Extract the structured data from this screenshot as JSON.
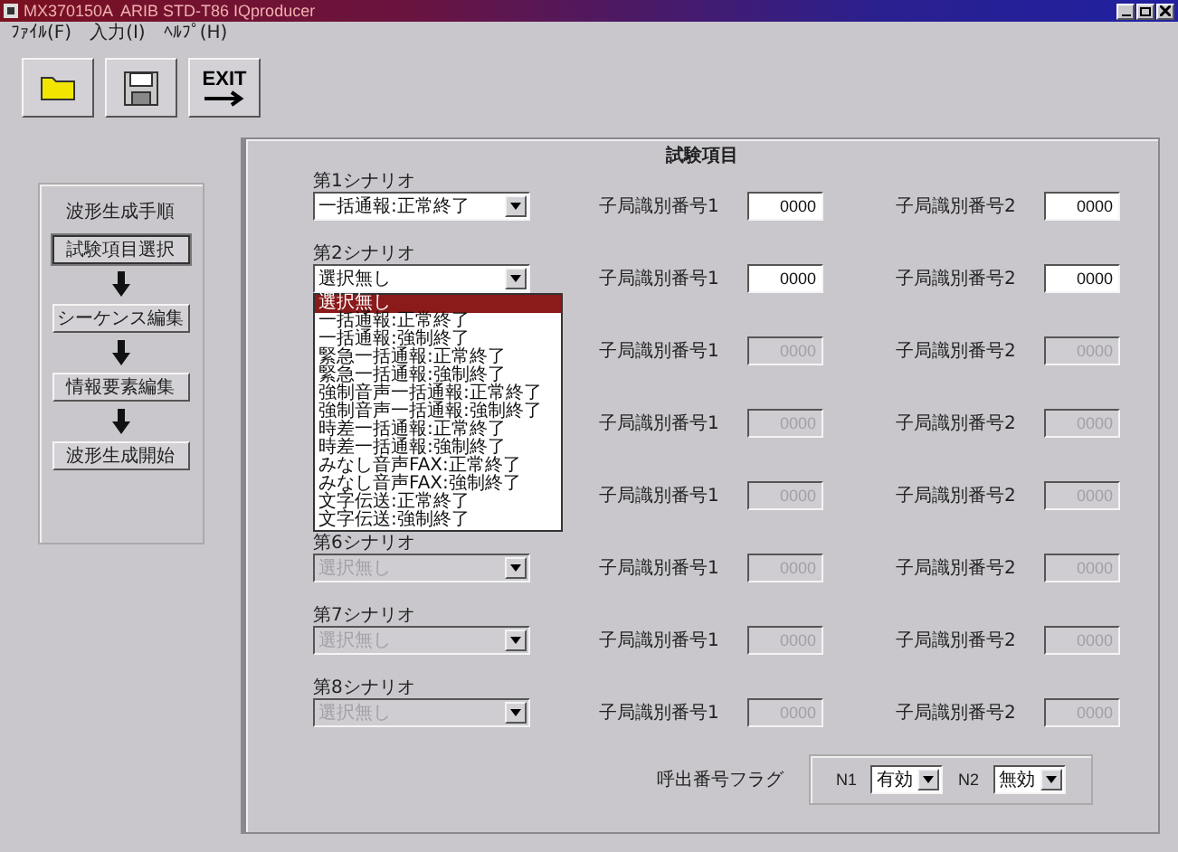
{
  "window": {
    "title": "MX370150A  ARIB STD-T86 IQproducer",
    "menu": [
      "ﾌｧｲﾙ(F)",
      "入力(I)",
      "ﾍﾙﾌﾟ(H)"
    ],
    "toolbar": [
      {
        "kind": "open"
      },
      {
        "kind": "save"
      },
      {
        "kind": "exit",
        "label": "EXIT"
      }
    ]
  },
  "procedure": {
    "title": "波形生成手順",
    "steps": [
      {
        "label": "試験項目選択",
        "selected": true
      },
      {
        "label": "シーケンス編集",
        "selected": false
      },
      {
        "label": "情報要素編集",
        "selected": false
      },
      {
        "label": "波形生成開始",
        "selected": false
      }
    ]
  },
  "panel": {
    "title": "試験項目",
    "scenarios": [
      {
        "label": "第1シナリオ",
        "value": "一括通報:正常終了",
        "disabled": false,
        "field1_label": "子局識別番号1",
        "field1": "0000",
        "field2_label": "子局識別番号2",
        "field2": "0000"
      },
      {
        "label": "第2シナリオ",
        "value": "選択無し",
        "disabled": false,
        "open": true,
        "field1_label": "子局識別番号1",
        "field1": "0000",
        "field2_label": "子局識別番号2",
        "field2": "0000",
        "options": [
          {
            "label": "選択無し",
            "selected": true
          },
          {
            "label": "一括通報:正常終了",
            "selected": false
          },
          {
            "label": "一括通報:強制終了",
            "selected": false
          },
          {
            "label": "緊急一括通報:正常終了",
            "selected": false
          },
          {
            "label": "緊急一括通報:強制終了",
            "selected": false
          },
          {
            "label": "強制音声一括通報:正常終了",
            "selected": false
          },
          {
            "label": "強制音声一括通報:強制終了",
            "selected": false
          },
          {
            "label": "時差一括通報:正常終了",
            "selected": false
          },
          {
            "label": "時差一括通報:強制終了",
            "selected": false
          },
          {
            "label": "みなし音声FAX:正常終了",
            "selected": false
          },
          {
            "label": "みなし音声FAX:強制終了",
            "selected": false
          },
          {
            "label": "文字伝送:正常終了",
            "selected": false
          },
          {
            "label": "文字伝送:強制終了",
            "selected": false
          }
        ]
      },
      {
        "disabled": true,
        "field1_label": "子局識別番号1",
        "field1": "0000",
        "field2_label": "子局識別番号2",
        "field2": "0000"
      },
      {
        "disabled": true,
        "field1_label": "子局識別番号1",
        "field1": "0000",
        "field2_label": "子局識別番号2",
        "field2": "0000"
      },
      {
        "disabled": true,
        "field1_label": "子局識別番号1",
        "field1": "0000",
        "field2_label": "子局識別番号2",
        "field2": "0000"
      },
      {
        "label": "第6シナリオ",
        "value": "選択無し",
        "disabled": true,
        "field1_label": "子局識別番号1",
        "field1": "0000",
        "field2_label": "子局識別番号2",
        "field2": "0000"
      },
      {
        "label": "第7シナリオ",
        "value": "選択無し",
        "disabled": true,
        "field1_label": "子局識別番号1",
        "field1": "0000",
        "field2_label": "子局識別番号2",
        "field2": "0000"
      },
      {
        "label": "第8シナリオ",
        "value": "選択無し",
        "disabled": true,
        "field1_label": "子局識別番号1",
        "field1": "0000",
        "field2_label": "子局識別番号2",
        "field2": "0000"
      }
    ],
    "flags": {
      "label": "呼出番号フラグ",
      "items": [
        {
          "name": "N1",
          "value": "有効"
        },
        {
          "name": "N2",
          "value": "無効"
        }
      ]
    }
  }
}
